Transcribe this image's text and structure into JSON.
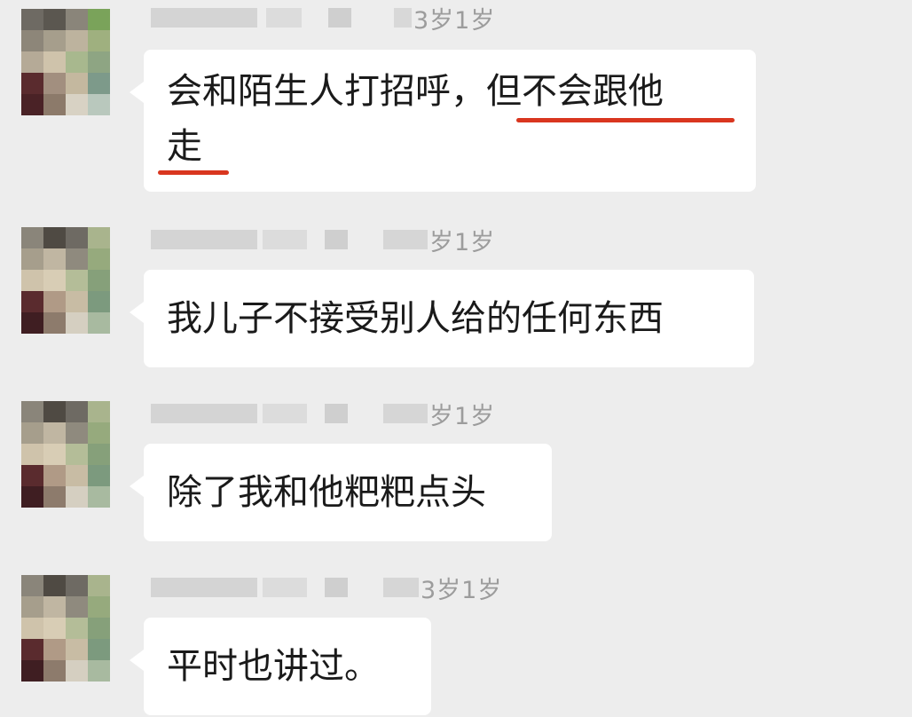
{
  "messages": [
    {
      "nickname_suffix": "3岁1岁",
      "text_line1_plain": "会和陌生人打招呼，",
      "text_line1_highlight": "但不会跟他",
      "text_line2_highlight": "走"
    },
    {
      "nickname_suffix": "岁1岁",
      "text": "我儿子不接受别人给的任何东西"
    },
    {
      "nickname_suffix": "岁1岁",
      "text": "除了我和他粑粑点头"
    },
    {
      "nickname_suffix": "3岁1岁",
      "text": "平时也讲过。"
    }
  ],
  "colors": {
    "background": "#ededed",
    "bubble": "#ffffff",
    "underline": "#d9361f",
    "meta_text": "#9c9c9c"
  }
}
